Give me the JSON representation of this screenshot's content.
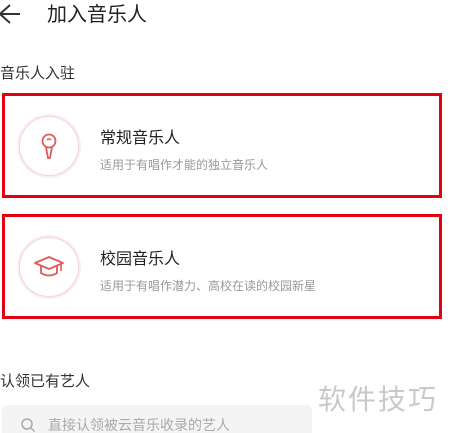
{
  "header": {
    "title": "加入音乐人"
  },
  "section_join": {
    "title": "音乐人入驻"
  },
  "cards": [
    {
      "title": "常规音乐人",
      "description": "适用于有唱作才能的独立音乐人",
      "icon": "microphone-icon"
    },
    {
      "title": "校园音乐人",
      "description": "适用于有唱作潜力、高校在读的校园新星",
      "icon": "graduation-cap-icon"
    }
  ],
  "section_claim": {
    "title": "认领已有艺人"
  },
  "search": {
    "placeholder": "直接认领被云音乐收录的艺人"
  },
  "watermark": "软件技巧",
  "colors": {
    "highlight_border": "#e3000f",
    "accent": "#e05a5a"
  }
}
